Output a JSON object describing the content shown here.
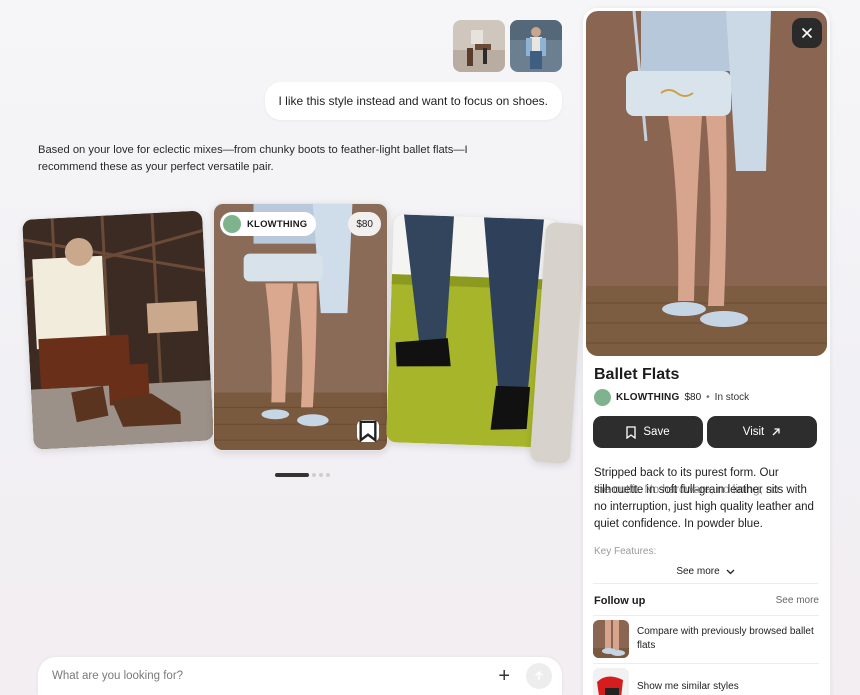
{
  "user_message": "I like this style instead and want to focus on shoes.",
  "assistant_message": "Based on your love for eclectic mixes—from chunky boots to feather-light ballet flats—I recommend these as your perfect versatile pair.",
  "carousel": {
    "featured": {
      "brand": "KLOWTHING",
      "price": "$80"
    }
  },
  "search": {
    "placeholder": "What are you looking for?"
  },
  "product": {
    "title": "Ballet Flats",
    "brand": "KLOWTHING",
    "price": "$80",
    "separator": "•",
    "stock": "In stock",
    "save_label": "Save",
    "visit_label": "Visit",
    "description": "Stripped back to its purest form. Our silhouette in soft full-grain leather sits with no interruption, just high quality leather and quiet confidence. In powder blue.",
    "description_ghost": "the outfit. No hardware, no lining, no",
    "key_features_label": "Key Features:",
    "see_more_label": "See more"
  },
  "follow_up": {
    "title": "Follow up",
    "see_more": "See more",
    "items": [
      {
        "text": "Compare with previously browsed ballet flats"
      },
      {
        "text": "Show me similar styles"
      }
    ]
  },
  "colors": {
    "brand_green": "#7fb38e",
    "dark_button": "#2d2d2d",
    "powder_blue": "#c9d8e6"
  }
}
